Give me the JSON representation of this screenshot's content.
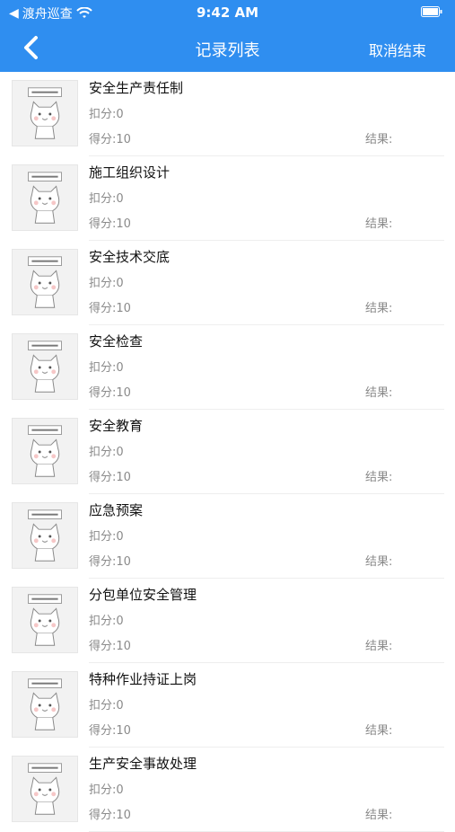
{
  "status_bar": {
    "carrier": "渡舟巡查",
    "time": "9:42 AM"
  },
  "nav": {
    "title": "记录列表",
    "action_label": "取消结束"
  },
  "list": [
    {
      "name": "安全生产责任制",
      "deduct": "扣分:0",
      "score": "得分:10",
      "result": "结果:"
    },
    {
      "name": "施工组织设计",
      "deduct": "扣分:0",
      "score": "得分:10",
      "result": "结果:"
    },
    {
      "name": "安全技术交底",
      "deduct": "扣分:0",
      "score": "得分:10",
      "result": "结果:"
    },
    {
      "name": "安全检查",
      "deduct": "扣分:0",
      "score": "得分:10",
      "result": "结果:"
    },
    {
      "name": "安全教育",
      "deduct": "扣分:0",
      "score": "得分:10",
      "result": "结果:"
    },
    {
      "name": "应急预案",
      "deduct": "扣分:0",
      "score": "得分:10",
      "result": "结果:"
    },
    {
      "name": "分包单位安全管理",
      "deduct": "扣分:0",
      "score": "得分:10",
      "result": "结果:"
    },
    {
      "name": "特种作业持证上岗",
      "deduct": "扣分:0",
      "score": "得分:10",
      "result": "结果:"
    },
    {
      "name": "生产安全事故处理",
      "deduct": "扣分:0",
      "score": "得分:10",
      "result": "结果:"
    }
  ],
  "colors": {
    "header": "#2f8ef0"
  }
}
